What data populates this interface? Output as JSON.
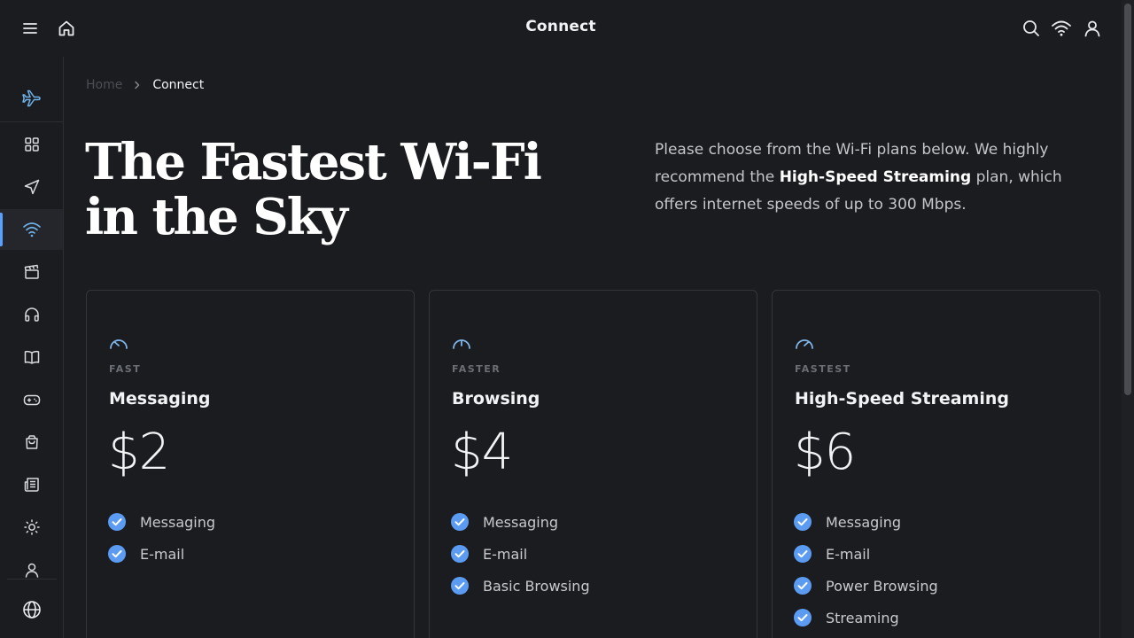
{
  "header": {
    "title": "Connect"
  },
  "breadcrumb": {
    "home": "Home",
    "current": "Connect"
  },
  "hero": {
    "title": "The Fastest Wi-Fi in the Sky",
    "desc_before": "Please choose from the Wi-Fi plans below. We highly recommend the ",
    "desc_highlight": "High-Speed Streaming",
    "desc_after": " plan, which offers internet speeds of up to 300 Mbps."
  },
  "sidebar": {
    "items": [
      {
        "icon": "grid-icon"
      },
      {
        "icon": "navigation-icon"
      },
      {
        "icon": "wifi-icon",
        "active": true
      },
      {
        "icon": "clapperboard-icon"
      },
      {
        "icon": "headphones-icon"
      },
      {
        "icon": "book-icon"
      },
      {
        "icon": "gamepad-icon"
      },
      {
        "icon": "shopping-bag-icon"
      },
      {
        "icon": "newspaper-icon"
      },
      {
        "icon": "sun-icon"
      },
      {
        "icon": "user-icon"
      }
    ],
    "bottom_icon": "globe-icon"
  },
  "plans": [
    {
      "tier": "FAST",
      "name": "Messaging",
      "price": "$2",
      "features": [
        "Messaging",
        "E-mail"
      ]
    },
    {
      "tier": "FASTER",
      "name": "Browsing",
      "price": "$4",
      "features": [
        "Messaging",
        "E-mail",
        "Basic Browsing"
      ]
    },
    {
      "tier": "FASTEST",
      "name": "High-Speed Streaming",
      "price": "$6",
      "features": [
        "Messaging",
        "E-mail",
        "Power Browsing",
        "Streaming"
      ]
    }
  ],
  "colors": {
    "background": "#1b1c20",
    "accent": "#5aa0ff",
    "check": "#5b9cf2",
    "speed_icon": "#7fb5e8"
  }
}
